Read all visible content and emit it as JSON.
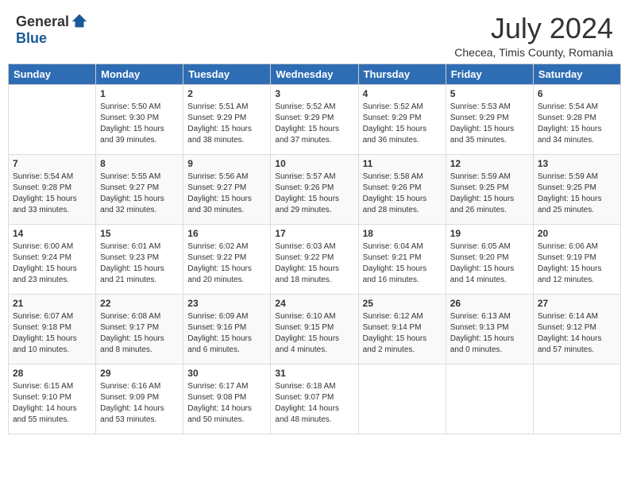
{
  "header": {
    "logo_general": "General",
    "logo_blue": "Blue",
    "month_year": "July 2024",
    "location": "Checea, Timis County, Romania"
  },
  "weekdays": [
    "Sunday",
    "Monday",
    "Tuesday",
    "Wednesday",
    "Thursday",
    "Friday",
    "Saturday"
  ],
  "weeks": [
    [
      {
        "day": "",
        "sunrise": "",
        "sunset": "",
        "daylight": ""
      },
      {
        "day": "1",
        "sunrise": "Sunrise: 5:50 AM",
        "sunset": "Sunset: 9:30 PM",
        "daylight": "Daylight: 15 hours and 39 minutes."
      },
      {
        "day": "2",
        "sunrise": "Sunrise: 5:51 AM",
        "sunset": "Sunset: 9:29 PM",
        "daylight": "Daylight: 15 hours and 38 minutes."
      },
      {
        "day": "3",
        "sunrise": "Sunrise: 5:52 AM",
        "sunset": "Sunset: 9:29 PM",
        "daylight": "Daylight: 15 hours and 37 minutes."
      },
      {
        "day": "4",
        "sunrise": "Sunrise: 5:52 AM",
        "sunset": "Sunset: 9:29 PM",
        "daylight": "Daylight: 15 hours and 36 minutes."
      },
      {
        "day": "5",
        "sunrise": "Sunrise: 5:53 AM",
        "sunset": "Sunset: 9:29 PM",
        "daylight": "Daylight: 15 hours and 35 minutes."
      },
      {
        "day": "6",
        "sunrise": "Sunrise: 5:54 AM",
        "sunset": "Sunset: 9:28 PM",
        "daylight": "Daylight: 15 hours and 34 minutes."
      }
    ],
    [
      {
        "day": "7",
        "sunrise": "Sunrise: 5:54 AM",
        "sunset": "Sunset: 9:28 PM",
        "daylight": "Daylight: 15 hours and 33 minutes."
      },
      {
        "day": "8",
        "sunrise": "Sunrise: 5:55 AM",
        "sunset": "Sunset: 9:27 PM",
        "daylight": "Daylight: 15 hours and 32 minutes."
      },
      {
        "day": "9",
        "sunrise": "Sunrise: 5:56 AM",
        "sunset": "Sunset: 9:27 PM",
        "daylight": "Daylight: 15 hours and 30 minutes."
      },
      {
        "day": "10",
        "sunrise": "Sunrise: 5:57 AM",
        "sunset": "Sunset: 9:26 PM",
        "daylight": "Daylight: 15 hours and 29 minutes."
      },
      {
        "day": "11",
        "sunrise": "Sunrise: 5:58 AM",
        "sunset": "Sunset: 9:26 PM",
        "daylight": "Daylight: 15 hours and 28 minutes."
      },
      {
        "day": "12",
        "sunrise": "Sunrise: 5:59 AM",
        "sunset": "Sunset: 9:25 PM",
        "daylight": "Daylight: 15 hours and 26 minutes."
      },
      {
        "day": "13",
        "sunrise": "Sunrise: 5:59 AM",
        "sunset": "Sunset: 9:25 PM",
        "daylight": "Daylight: 15 hours and 25 minutes."
      }
    ],
    [
      {
        "day": "14",
        "sunrise": "Sunrise: 6:00 AM",
        "sunset": "Sunset: 9:24 PM",
        "daylight": "Daylight: 15 hours and 23 minutes."
      },
      {
        "day": "15",
        "sunrise": "Sunrise: 6:01 AM",
        "sunset": "Sunset: 9:23 PM",
        "daylight": "Daylight: 15 hours and 21 minutes."
      },
      {
        "day": "16",
        "sunrise": "Sunrise: 6:02 AM",
        "sunset": "Sunset: 9:22 PM",
        "daylight": "Daylight: 15 hours and 20 minutes."
      },
      {
        "day": "17",
        "sunrise": "Sunrise: 6:03 AM",
        "sunset": "Sunset: 9:22 PM",
        "daylight": "Daylight: 15 hours and 18 minutes."
      },
      {
        "day": "18",
        "sunrise": "Sunrise: 6:04 AM",
        "sunset": "Sunset: 9:21 PM",
        "daylight": "Daylight: 15 hours and 16 minutes."
      },
      {
        "day": "19",
        "sunrise": "Sunrise: 6:05 AM",
        "sunset": "Sunset: 9:20 PM",
        "daylight": "Daylight: 15 hours and 14 minutes."
      },
      {
        "day": "20",
        "sunrise": "Sunrise: 6:06 AM",
        "sunset": "Sunset: 9:19 PM",
        "daylight": "Daylight: 15 hours and 12 minutes."
      }
    ],
    [
      {
        "day": "21",
        "sunrise": "Sunrise: 6:07 AM",
        "sunset": "Sunset: 9:18 PM",
        "daylight": "Daylight: 15 hours and 10 minutes."
      },
      {
        "day": "22",
        "sunrise": "Sunrise: 6:08 AM",
        "sunset": "Sunset: 9:17 PM",
        "daylight": "Daylight: 15 hours and 8 minutes."
      },
      {
        "day": "23",
        "sunrise": "Sunrise: 6:09 AM",
        "sunset": "Sunset: 9:16 PM",
        "daylight": "Daylight: 15 hours and 6 minutes."
      },
      {
        "day": "24",
        "sunrise": "Sunrise: 6:10 AM",
        "sunset": "Sunset: 9:15 PM",
        "daylight": "Daylight: 15 hours and 4 minutes."
      },
      {
        "day": "25",
        "sunrise": "Sunrise: 6:12 AM",
        "sunset": "Sunset: 9:14 PM",
        "daylight": "Daylight: 15 hours and 2 minutes."
      },
      {
        "day": "26",
        "sunrise": "Sunrise: 6:13 AM",
        "sunset": "Sunset: 9:13 PM",
        "daylight": "Daylight: 15 hours and 0 minutes."
      },
      {
        "day": "27",
        "sunrise": "Sunrise: 6:14 AM",
        "sunset": "Sunset: 9:12 PM",
        "daylight": "Daylight: 14 hours and 57 minutes."
      }
    ],
    [
      {
        "day": "28",
        "sunrise": "Sunrise: 6:15 AM",
        "sunset": "Sunset: 9:10 PM",
        "daylight": "Daylight: 14 hours and 55 minutes."
      },
      {
        "day": "29",
        "sunrise": "Sunrise: 6:16 AM",
        "sunset": "Sunset: 9:09 PM",
        "daylight": "Daylight: 14 hours and 53 minutes."
      },
      {
        "day": "30",
        "sunrise": "Sunrise: 6:17 AM",
        "sunset": "Sunset: 9:08 PM",
        "daylight": "Daylight: 14 hours and 50 minutes."
      },
      {
        "day": "31",
        "sunrise": "Sunrise: 6:18 AM",
        "sunset": "Sunset: 9:07 PM",
        "daylight": "Daylight: 14 hours and 48 minutes."
      },
      {
        "day": "",
        "sunrise": "",
        "sunset": "",
        "daylight": ""
      },
      {
        "day": "",
        "sunrise": "",
        "sunset": "",
        "daylight": ""
      },
      {
        "day": "",
        "sunrise": "",
        "sunset": "",
        "daylight": ""
      }
    ]
  ]
}
